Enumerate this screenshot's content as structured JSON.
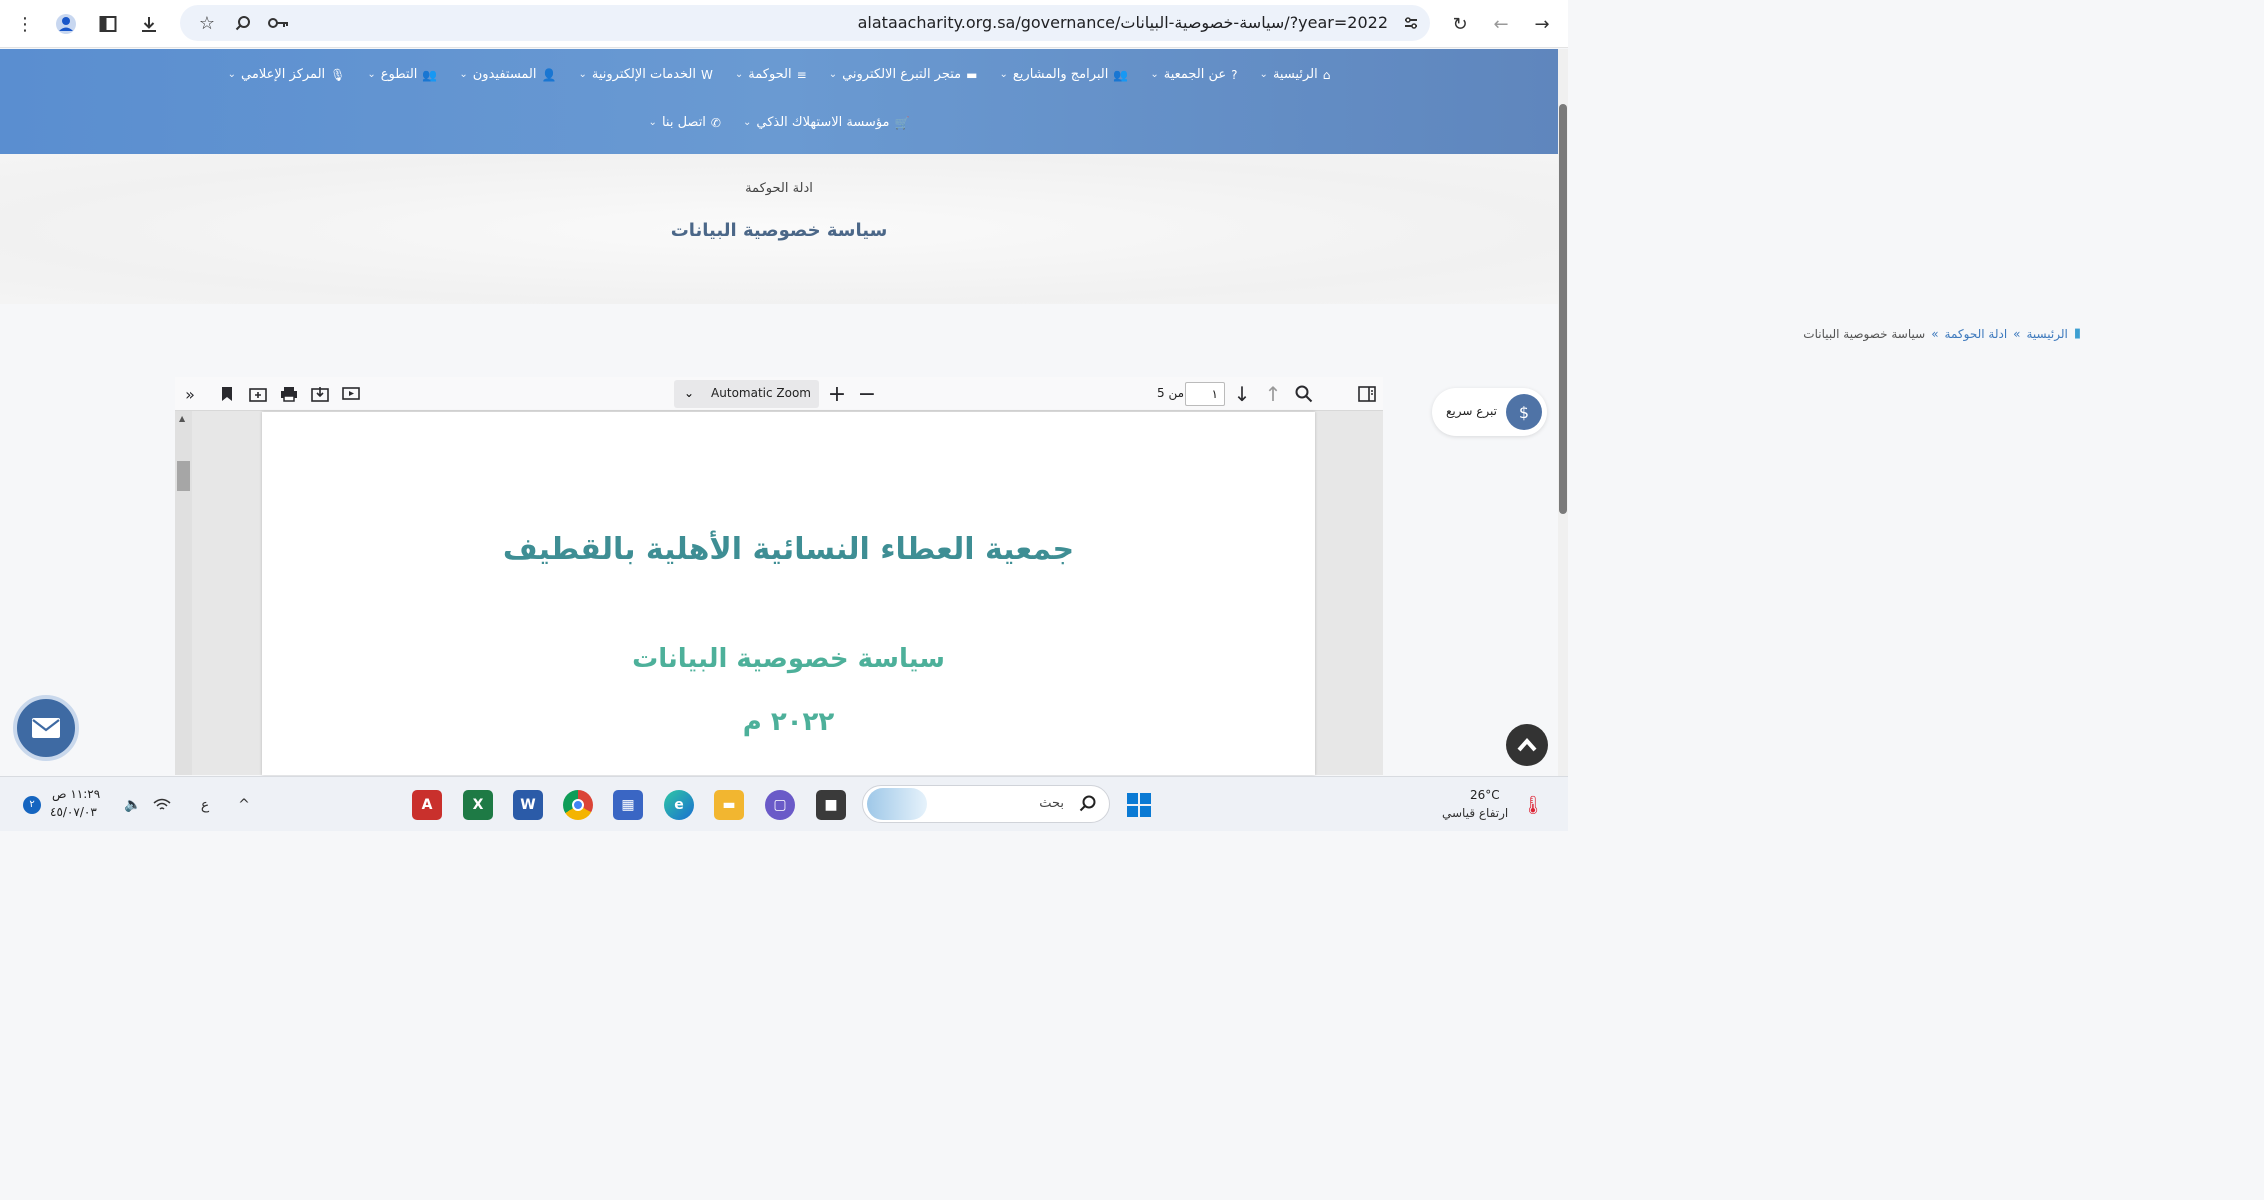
{
  "browser": {
    "url": "alataacharity.org.sa/governance/سياسة-خصوصية-البيانات/?year=2022"
  },
  "nav": {
    "row1": [
      {
        "label": "الرئيسية",
        "icon": "⌂"
      },
      {
        "label": "عن الجمعية",
        "icon": "?"
      },
      {
        "label": "البرامج والمشاريع",
        "icon": "👥"
      },
      {
        "label": "متجر التبرع الالكتروني",
        "icon": "▬"
      },
      {
        "label": "الحوكمة",
        "icon": "≡"
      },
      {
        "label": "الخدمات الإلكترونية",
        "icon": "W"
      },
      {
        "label": "المستفيدون",
        "icon": "👤"
      },
      {
        "label": "التطوع",
        "icon": "👥"
      },
      {
        "label": "المركز الإعلامي",
        "icon": "🎙"
      }
    ],
    "row2": [
      {
        "label": "مؤسسة الاستهلاك الذكي",
        "icon": "🛒"
      },
      {
        "label": "اتصل بنا",
        "icon": "✆"
      }
    ]
  },
  "hero": {
    "pre_title": "ادلة الحوكمة",
    "title": "سياسة خصوصية البيانات"
  },
  "breadcrumb": {
    "home": "الرئيسية",
    "sep": "»",
    "section": "ادلة الحوكمة",
    "current": "سياسة خصوصية البيانات"
  },
  "pdf": {
    "zoom": "Automatic Zoom",
    "page_input": "١",
    "page_of": "من 5",
    "org_name": "جمعية العطاء النسائية الأهلية بالقطيف",
    "doc_title": "سياسة خصوصية البيانات",
    "doc_year": "٢٠٢٢ م"
  },
  "quick_donate": {
    "label": "تبرع سريع"
  },
  "taskbar": {
    "search_placeholder": "بحث",
    "temp": "26°C",
    "weather": "ارتفاع قياسي",
    "time": "١١:٢٩ ص",
    "date": "٤٥/٠٧/٠٣",
    "lang": "ع",
    "notif_count": "٢"
  }
}
